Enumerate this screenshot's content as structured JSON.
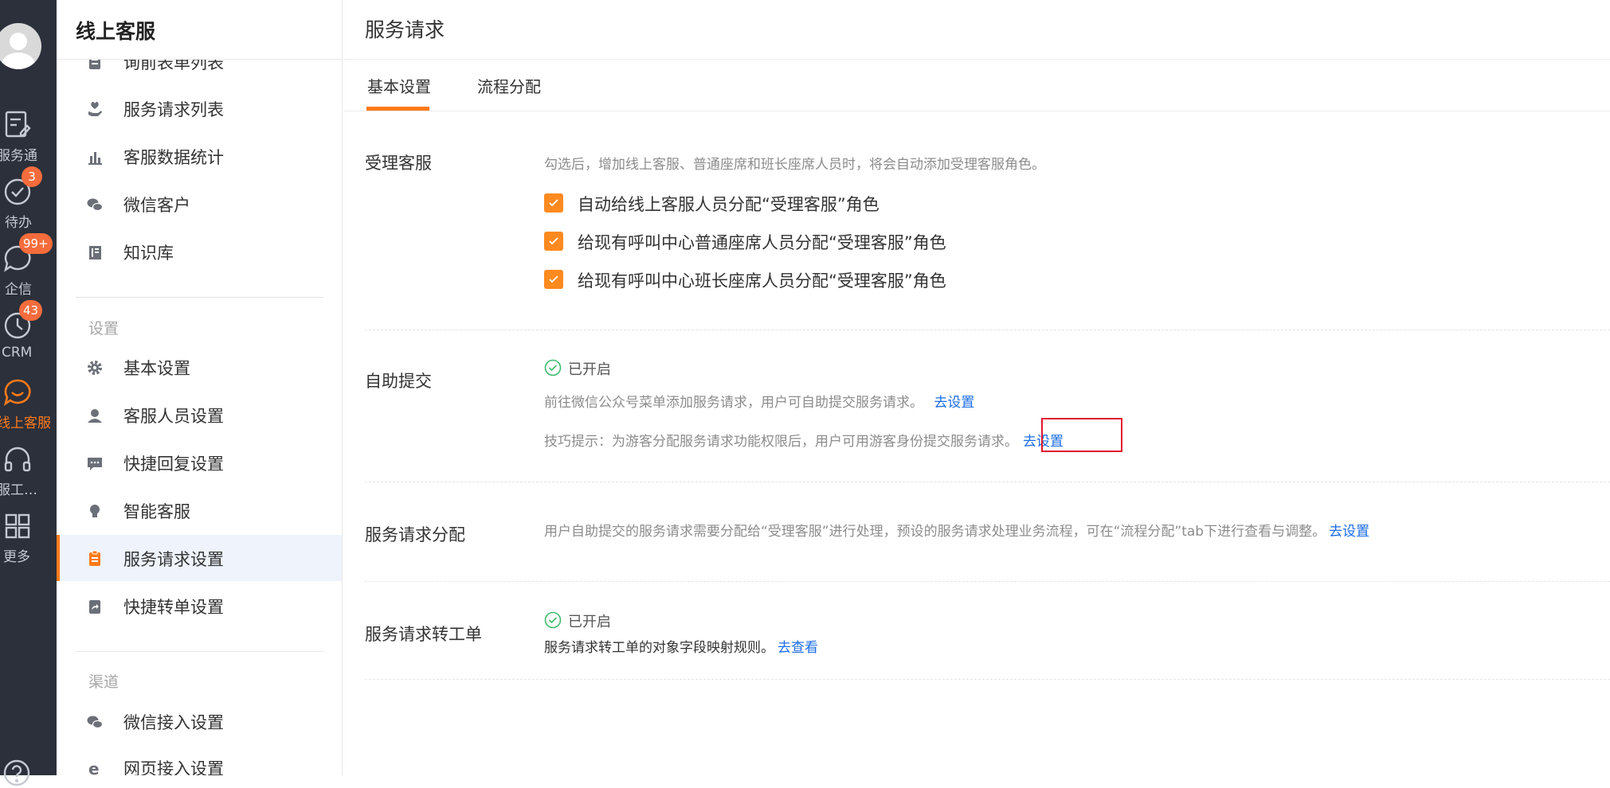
{
  "rail": {
    "items": [
      {
        "label": "服务通",
        "icon": "clipboard-edit-icon"
      },
      {
        "label": "待办",
        "icon": "check-circle-icon",
        "badge": "3"
      },
      {
        "label": "企信",
        "icon": "chat-bubble-icon",
        "badge": "99+"
      },
      {
        "label": "CRM",
        "icon": "clock-icon",
        "badge": "43"
      },
      {
        "label": "线上客服",
        "icon": "smile-chat-icon",
        "active": true
      },
      {
        "label": "服工…",
        "icon": "headset-icon"
      },
      {
        "label": "更多",
        "icon": "grid-icon"
      }
    ],
    "help_icon": "help-circle-icon",
    "active_color": "#ff7a1a"
  },
  "sidebar": {
    "title": "线上客服",
    "items": [
      {
        "label": "询前表单列表",
        "icon": "form-list-icon"
      },
      {
        "label": "服务请求列表",
        "icon": "hand-heart-icon"
      },
      {
        "label": "客服数据统计",
        "icon": "bar-chart-icon"
      },
      {
        "label": "微信客户",
        "icon": "wechat-icon"
      },
      {
        "label": "知识库",
        "icon": "book-icon"
      }
    ],
    "settings_group": "设置",
    "settings_items": [
      {
        "label": "基本设置",
        "icon": "gear-icon"
      },
      {
        "label": "客服人员设置",
        "icon": "agent-icon"
      },
      {
        "label": "快捷回复设置",
        "icon": "message-dots-icon"
      },
      {
        "label": "智能客服",
        "icon": "bulb-icon"
      },
      {
        "label": "服务请求设置",
        "icon": "clipboard-icon",
        "active": true
      },
      {
        "label": "快捷转单设置",
        "icon": "transfer-icon"
      }
    ],
    "channel_group": "渠道",
    "channel_items": [
      {
        "label": "微信接入设置",
        "icon": "wechat-icon"
      },
      {
        "label": "网页接入设置",
        "icon": "browser-e-icon"
      }
    ]
  },
  "main": {
    "title": "服务请求",
    "tabs": [
      {
        "label": "基本设置",
        "active": true
      },
      {
        "label": "流程分配"
      }
    ],
    "sections": {
      "agent": {
        "label": "受理客服",
        "hint": "勾选后，增加线上客服、普通座席和班长座席人员时，将会自动添加受理客服角色。",
        "checkboxes": [
          {
            "label": "自动给线上客服人员分配“受理客服”角色",
            "checked": true
          },
          {
            "label": "给现有呼叫中心普通座席人员分配“受理客服”角色",
            "checked": true
          },
          {
            "label": "给现有呼叫中心班长座席人员分配“受理客服”角色",
            "checked": true
          }
        ]
      },
      "self_submit": {
        "label": "自助提交",
        "status": "已开启",
        "desc": "前往微信公众号菜单添加服务请求，用户可自助提交服务请求。",
        "desc_link": "去设置",
        "tip": "技巧提示：为游客分配服务请求功能权限后，用户可用游客身份提交服务请求。",
        "tip_link": "去设置"
      },
      "assign": {
        "label": "服务请求分配",
        "desc": "用户自助提交的服务请求需要分配给“受理客服”进行处理，预设的服务请求处理业务流程，可在“流程分配”tab下进行查看与调整。",
        "link": "去设置"
      },
      "ticket": {
        "label": "服务请求转工单",
        "status": "已开启",
        "desc": "服务请求转工单的对象字段映射规则。",
        "link": "去查看"
      }
    },
    "colors": {
      "accent": "#ff7a1a",
      "link": "#1a6ce6",
      "success": "#3dbb6b",
      "highlight": "#e0182f"
    }
  }
}
